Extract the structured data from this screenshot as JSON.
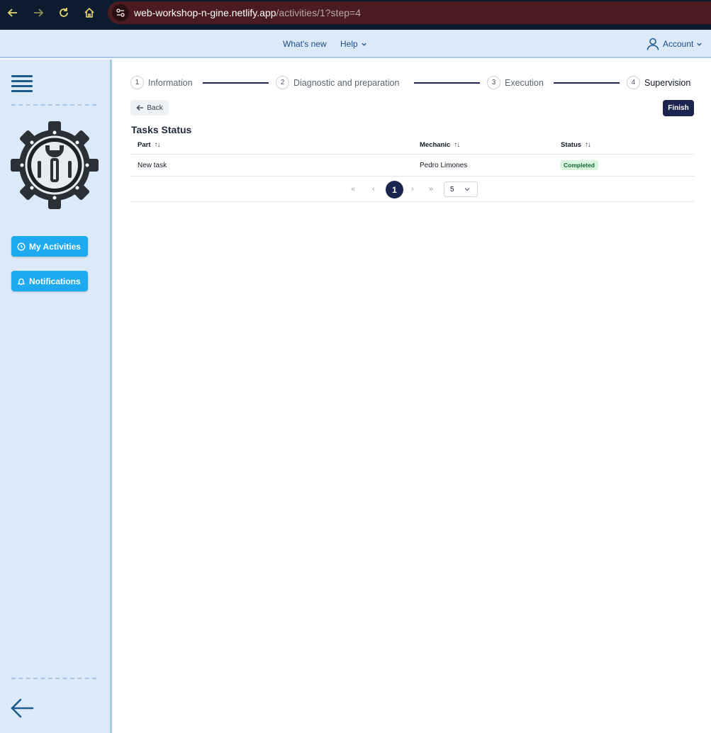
{
  "browser": {
    "url_host": "web-workshop-n-gine.netlify.app",
    "url_path": "/activities/1?step=4"
  },
  "topbar": {
    "whats_new": "What's new",
    "help": "Help",
    "account": "Account"
  },
  "sidebar": {
    "items": [
      {
        "label": "My Activities",
        "icon": "clock-icon"
      },
      {
        "label": "Notifications",
        "icon": "bell-icon"
      }
    ]
  },
  "stepper": {
    "steps": [
      {
        "num": "1",
        "label": "Information"
      },
      {
        "num": "2",
        "label": "Diagnostic and preparation"
      },
      {
        "num": "3",
        "label": "Execution"
      },
      {
        "num": "4",
        "label": "Supervision",
        "active": true
      }
    ]
  },
  "actions": {
    "back": "Back",
    "finish": "Finish"
  },
  "tasks": {
    "title": "Tasks Status",
    "columns": [
      "Part",
      "Mechanic",
      "Status"
    ],
    "sort_glyph": "↑↓",
    "rows": [
      {
        "part": "New task",
        "mechanic": "Pedro Limones",
        "status": "Completed"
      }
    ]
  },
  "pagination": {
    "first": "«",
    "prev": "‹",
    "current": "1",
    "next": "›",
    "last": "»",
    "page_size": "5"
  },
  "colors": {
    "accent": "#1b2550",
    "sidebar_bg": "#dbe9f8",
    "button_blue": "#1eaaf0",
    "completed_bg": "#d8f5df"
  }
}
